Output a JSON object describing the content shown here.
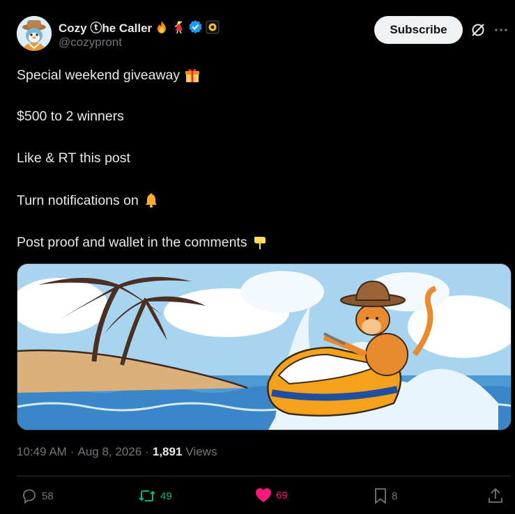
{
  "author": {
    "display_name": "Cozy ⓣhe Caller",
    "handle": "@cozypront",
    "emojis": [
      "fire-emoji",
      "dancer-emoji"
    ],
    "badges": [
      "verified-badge-icon",
      "affiliate-badge-icon"
    ]
  },
  "header": {
    "subscribe_label": "Subscribe",
    "icons": [
      "grok-icon",
      "more-icon"
    ]
  },
  "tweet": {
    "lines": [
      "Special weekend giveaway",
      "$500 to 2 winners",
      "Like & RT this post",
      "Turn notifications on",
      "Post proof and wallet in the comments"
    ],
    "line_emojis": [
      "gift-emoji",
      "",
      "",
      "bell-emoji",
      "pointing-down-emoji"
    ]
  },
  "media": {
    "description_icon": "monkey-jetski-illustration"
  },
  "meta": {
    "time": "10:49 AM",
    "date": "Aug 8, 2026",
    "views_count": "1,891",
    "views_label": "Views",
    "separator": "·"
  },
  "actions": {
    "replies": "58",
    "reposts": "49",
    "likes": "69",
    "bookmarks": "8"
  },
  "colors": {
    "background": "#000000",
    "text": "#e7e9ea",
    "muted": "#71767b",
    "verified": "#1d9bf0",
    "repost": "#00ba7c",
    "like": "#f91880"
  }
}
